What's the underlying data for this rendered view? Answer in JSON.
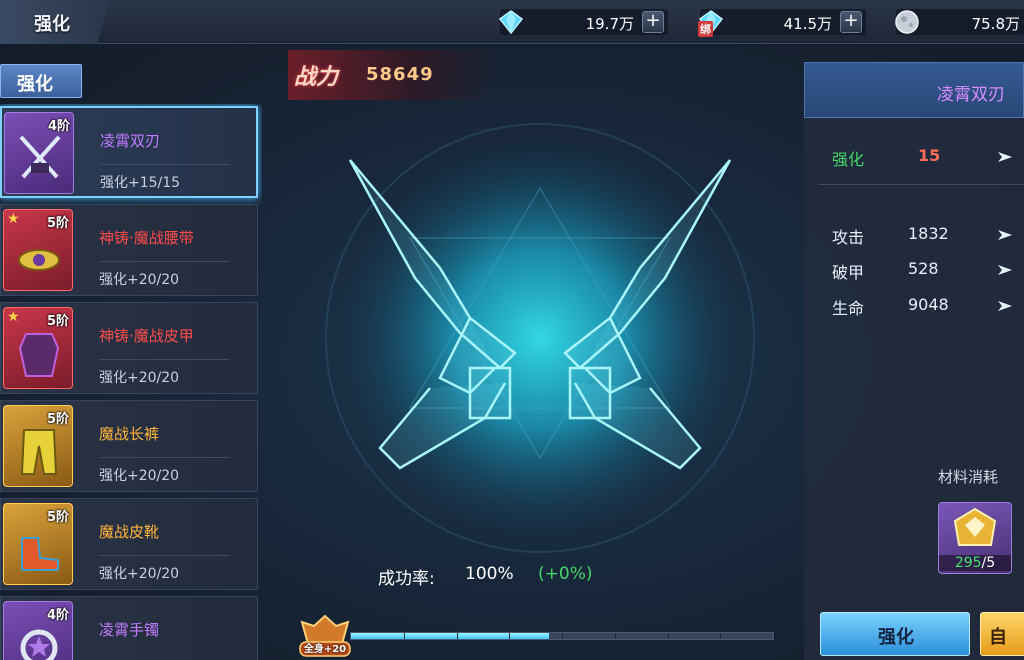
{
  "header": {
    "title": "强化",
    "resources": [
      {
        "icon": "diamond-icon",
        "value": "19.7万"
      },
      {
        "icon": "bound-diamond-icon",
        "badge": "绑",
        "value": "41.5万"
      },
      {
        "icon": "moon-coin-icon",
        "value": "75.8万"
      }
    ],
    "plus": "+"
  },
  "left": {
    "tab": "强化",
    "items": [
      {
        "name": "凌霄双刃",
        "tier": "4阶",
        "level": "强化+15/15",
        "quality": "purple",
        "star": false,
        "selected": true
      },
      {
        "name": "神铸·魔战腰带",
        "tier": "5阶",
        "level": "强化+20/20",
        "quality": "red",
        "star": true,
        "selected": false
      },
      {
        "name": "神铸·魔战皮甲",
        "tier": "5阶",
        "level": "强化+20/20",
        "quality": "red",
        "star": true,
        "selected": false
      },
      {
        "name": "魔战长裤",
        "tier": "5阶",
        "level": "强化+20/20",
        "quality": "gold",
        "star": false,
        "selected": false
      },
      {
        "name": "魔战皮靴",
        "tier": "5阶",
        "level": "强化+20/20",
        "quality": "gold",
        "star": false,
        "selected": false
      },
      {
        "name": "凌霄手镯",
        "tier": "4阶",
        "level": "",
        "quality": "purple",
        "star": false,
        "selected": false
      }
    ]
  },
  "center": {
    "power_label": "战力",
    "power_value": "58649",
    "rate_label": "成功率:",
    "rate_value": "100%",
    "rate_bonus": "(+0%)",
    "progress": {
      "badge": "全身+20",
      "fraction": 0.47,
      "segments": 8
    }
  },
  "right": {
    "item_name": "凌霄双刃",
    "strengthen_label": "强化",
    "strengthen_value": "15",
    "stats": [
      {
        "label": "攻击",
        "value": "1832"
      },
      {
        "label": "破甲",
        "value": "528"
      },
      {
        "label": "生命",
        "value": "9048"
      }
    ],
    "materials_label": "材料消耗",
    "material_have": "295",
    "material_need": "/5",
    "btn_strengthen": "强化",
    "btn_auto": "自"
  },
  "colors": {
    "accent": "#7ed0ff",
    "purple": "#c47cff",
    "red": "#ff4b4b",
    "gold": "#ffb43a",
    "green": "#44d66a",
    "strengthen_value": "#ff6b5b"
  }
}
